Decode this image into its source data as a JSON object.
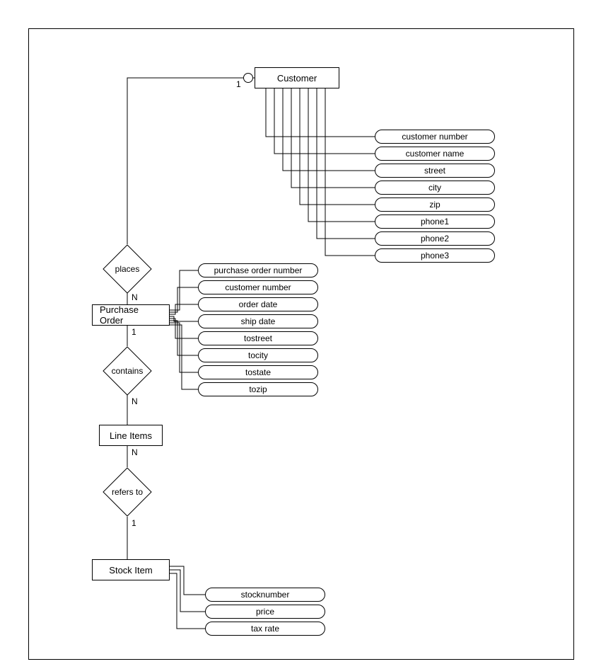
{
  "entities": {
    "customer": {
      "label": "Customer"
    },
    "purchase_order": {
      "label": "Purchase Order"
    },
    "line_items": {
      "label": "Line Items"
    },
    "stock_item": {
      "label": "Stock Item"
    }
  },
  "relationships": {
    "places": {
      "label": "places"
    },
    "contains": {
      "label": "contains"
    },
    "refers_to": {
      "label": "refers to"
    }
  },
  "cardinalities": {
    "customer_places": "1",
    "places_po_top": "N",
    "po_contains_top": "1",
    "contains_li_top": "N",
    "li_refers_top": "N",
    "refers_stock_top": "1"
  },
  "customer_attributes": [
    "customer number",
    "customer name",
    "street",
    "city",
    "zip",
    "phone1",
    "phone2",
    "phone3"
  ],
  "po_attributes": [
    "purchase order number",
    "customer number",
    "order date",
    "ship date",
    "tostreet",
    "tocity",
    "tostate",
    "tozip"
  ],
  "stock_attributes": [
    "stocknumber",
    "price",
    "tax rate"
  ]
}
